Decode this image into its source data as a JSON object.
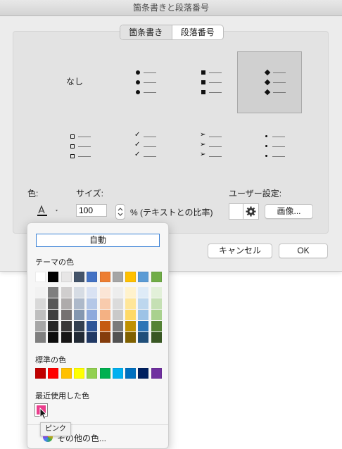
{
  "window": {
    "title": "箇条書きと段落番号"
  },
  "tabs": [
    {
      "label": "箇条書き",
      "selected": true
    },
    {
      "label": "段落番号",
      "selected": false
    }
  ],
  "bullets": {
    "none_label": "なし",
    "selected_index": 3
  },
  "labels": {
    "color": "色:",
    "size": "サイズ:",
    "percent_text": "% (テキストとの比率)",
    "user_setting": "ユーザー設定:"
  },
  "size_input": {
    "value": "100"
  },
  "buttons": {
    "image": "画像...",
    "cancel": "キャンセル",
    "ok": "OK"
  },
  "color_popup": {
    "auto_label": "自動",
    "theme_heading": "テーマの色",
    "theme_colors": [
      "#ffffff",
      "#000000",
      "#e7e6e6",
      "#44546a",
      "#4472c4",
      "#ed7d31",
      "#a5a5a5",
      "#ffc000",
      "#5b9bd5",
      "#70ad47"
    ],
    "theme_shades": [
      [
        "#f2f2f2",
        "#d9d9d9",
        "#bfbfbf",
        "#a6a6a6",
        "#7f7f7f"
      ],
      [
        "#7f7f7f",
        "#595959",
        "#404040",
        "#262626",
        "#0d0d0d"
      ],
      [
        "#d0cece",
        "#aeabab",
        "#757171",
        "#3a3838",
        "#171616"
      ],
      [
        "#d6dce4",
        "#adb9ca",
        "#8497b0",
        "#333f4f",
        "#222a35"
      ],
      [
        "#d9e2f3",
        "#b4c7e7",
        "#8faadc",
        "#2f5597",
        "#203864"
      ],
      [
        "#fbe5d6",
        "#f8cbad",
        "#f4b183",
        "#c55a11",
        "#843c0c"
      ],
      [
        "#ededed",
        "#dbdbdb",
        "#c9c9c9",
        "#7b7b7b",
        "#525252"
      ],
      [
        "#fff2cc",
        "#ffe699",
        "#ffd966",
        "#bf9000",
        "#7f6000"
      ],
      [
        "#deebf7",
        "#bdd7ee",
        "#9dc3e6",
        "#2e75b6",
        "#1f4e79"
      ],
      [
        "#e2f0d9",
        "#c5e0b4",
        "#a9d18e",
        "#548235",
        "#385723"
      ]
    ],
    "standard_heading": "標準の色",
    "standard_colors": [
      "#c00000",
      "#ff0000",
      "#ffc000",
      "#ffff00",
      "#92d050",
      "#00b050",
      "#00b0f0",
      "#0070c0",
      "#002060",
      "#7030a0"
    ],
    "recent_heading": "最近使用した色",
    "recent_colors": [
      "#ea3d8c"
    ],
    "more_colors_label": "その他の色...",
    "tooltip": "ピンク"
  },
  "icons": {
    "font_color": "font-color-icon",
    "gear": "gear-icon",
    "stepper": "stepper-icon",
    "cursor": "pointer-cursor-icon",
    "color_wheel": "color-wheel-icon"
  }
}
